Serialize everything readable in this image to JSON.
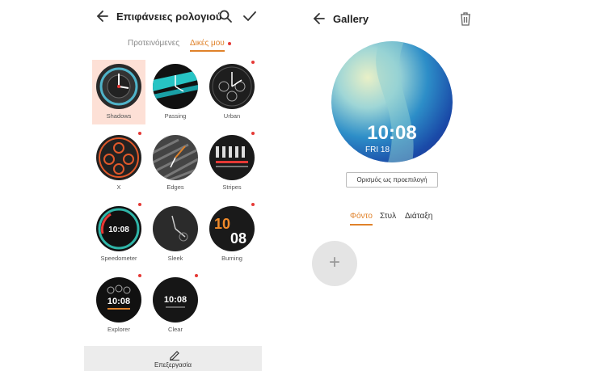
{
  "left": {
    "title": "Επιφάνειες ρολογιού",
    "tabs": [
      {
        "label": "Προτεινόμενες"
      },
      {
        "label": "Δικές μου"
      }
    ],
    "faces": [
      {
        "name": "Shadows",
        "selected": true
      },
      {
        "name": "Passing"
      },
      {
        "name": "Urban"
      },
      {
        "name": "X"
      },
      {
        "name": "Edges"
      },
      {
        "name": "Stripes"
      },
      {
        "name": "Speedometer"
      },
      {
        "name": "Sleek"
      },
      {
        "name": "Burning"
      },
      {
        "name": "Explorer"
      },
      {
        "name": "Clear"
      }
    ],
    "face_texts": {
      "speedometer": "10:08",
      "burning_h": "10",
      "burning_m": "08",
      "explorer": "10:08",
      "clear": "10:08"
    },
    "edit_label": "Επεξεργασία"
  },
  "right": {
    "title": "Gallery",
    "preview_time": "10:08",
    "preview_date": "FRI 18",
    "set_default": "Ορισμός ως προεπιλογή",
    "tabs": [
      {
        "label": "Φόντο"
      },
      {
        "label": "Στυλ"
      },
      {
        "label": "Διάταξη"
      }
    ],
    "add_symbol": "+"
  },
  "colors": {
    "accent": "#e0822a",
    "badge": "#e53935"
  }
}
